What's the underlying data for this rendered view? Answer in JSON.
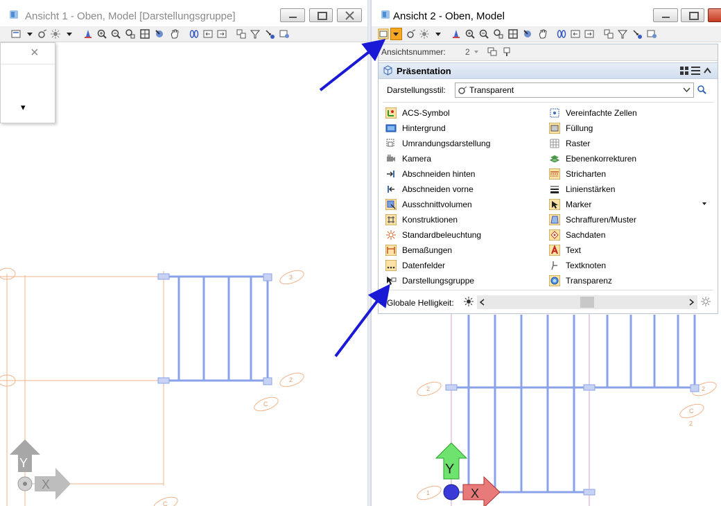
{
  "window1": {
    "title": "Ansicht 1 - Oben, Model [Darstellungsgruppe]",
    "grid_labels": [
      "3",
      "2",
      "C",
      "C"
    ],
    "axis_x": "X",
    "axis_y": "Y"
  },
  "window2": {
    "title": "Ansicht 2 - Oben, Model",
    "grid_labels": [
      "2",
      "2",
      "C",
      "2",
      "1"
    ],
    "axis_x": "X",
    "axis_y": "Y"
  },
  "popup_left": {
    "close_glyph": "×",
    "dropdown_glyph": "▾"
  },
  "dialog": {
    "view_number_label": "Ansichtsnummer:",
    "view_number_value": "2",
    "section_title": "Präsentation",
    "style_label": "Darstellungsstil:",
    "style_value": "Transparent",
    "left_items": [
      {
        "label": "ACS-Symbol",
        "icon": "acs-icon"
      },
      {
        "label": "Hintergrund",
        "icon": "background-icon"
      },
      {
        "label": "Umrandungsdarstellung",
        "icon": "boundary-icon"
      },
      {
        "label": "Kamera",
        "icon": "camera-icon"
      },
      {
        "label": "Abschneiden hinten",
        "icon": "clip-back-icon"
      },
      {
        "label": "Abschneiden vorne",
        "icon": "clip-front-icon"
      },
      {
        "label": "Ausschnittvolumen",
        "icon": "clip-volume-icon"
      },
      {
        "label": "Konstruktionen",
        "icon": "constructions-icon"
      },
      {
        "label": "Standardbeleuchtung",
        "icon": "lighting-icon"
      },
      {
        "label": "Bemaßungen",
        "icon": "dimensions-icon"
      },
      {
        "label": "Datenfelder",
        "icon": "data-fields-icon"
      },
      {
        "label": "Darstellungsgruppe",
        "icon": "display-set-icon"
      }
    ],
    "right_items": [
      {
        "label": "Vereinfachte Zellen",
        "icon": "fast-cells-icon"
      },
      {
        "label": "Füllung",
        "icon": "fill-icon"
      },
      {
        "label": "Raster",
        "icon": "grid-icon"
      },
      {
        "label": "Ebenenkorrekturen",
        "icon": "level-overrides-icon"
      },
      {
        "label": "Stricharten",
        "icon": "line-styles-icon"
      },
      {
        "label": "Linienstärken",
        "icon": "line-weights-icon"
      },
      {
        "label": "Marker",
        "icon": "marker-icon"
      },
      {
        "label": "Schraffuren/Muster",
        "icon": "patterns-icon"
      },
      {
        "label": "Sachdaten",
        "icon": "tags-icon"
      },
      {
        "label": "Text",
        "icon": "text-icon"
      },
      {
        "label": "Textknoten",
        "icon": "text-nodes-icon"
      },
      {
        "label": "Transparenz",
        "icon": "transparency-icon"
      }
    ],
    "brightness_label": "Globale Helligkeit:",
    "brightness_level": 0.5
  },
  "colors": {
    "accent_blue": "#2e2ed6",
    "grid_orange": "#f2b48a",
    "beam_blue": "#8aa2e8",
    "active_button": "#f5a623"
  }
}
